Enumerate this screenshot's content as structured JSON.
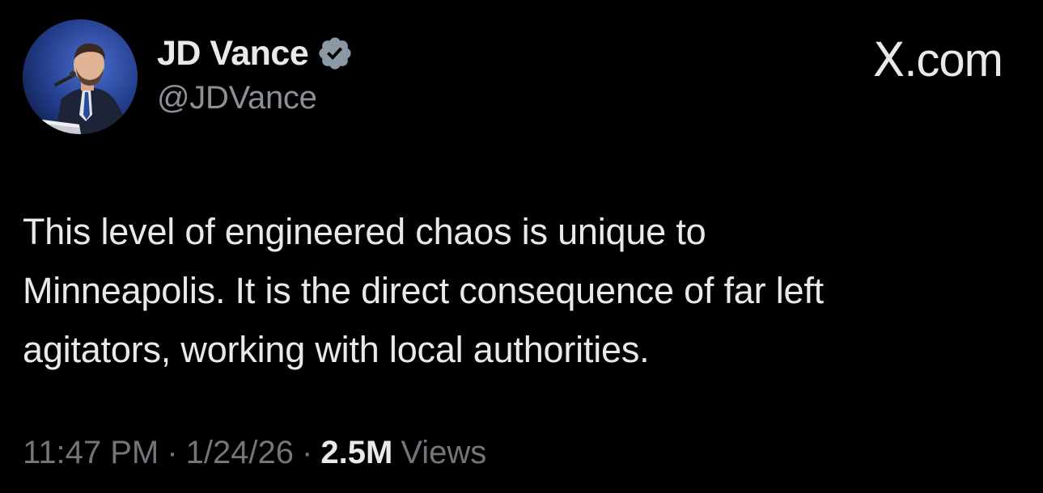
{
  "author": {
    "display_name": "JD Vance",
    "handle": "@JDVance",
    "verified": true,
    "verified_color": "#8b98a5"
  },
  "brand": {
    "prefix": "X",
    "suffix": ".com"
  },
  "tweet": {
    "lines": [
      "This level of engineered chaos is unique to",
      "Minneapolis. It is the direct consequence of far left",
      "agitators, working with local authorities."
    ]
  },
  "meta": {
    "time": "11:47 PM",
    "separator": "·",
    "date": "1/24/26",
    "views_count": "2.5M",
    "views_label": "Views"
  },
  "colors": {
    "background": "#000000",
    "primary_text": "#e7e9ea",
    "secondary_text": "#71767b"
  }
}
